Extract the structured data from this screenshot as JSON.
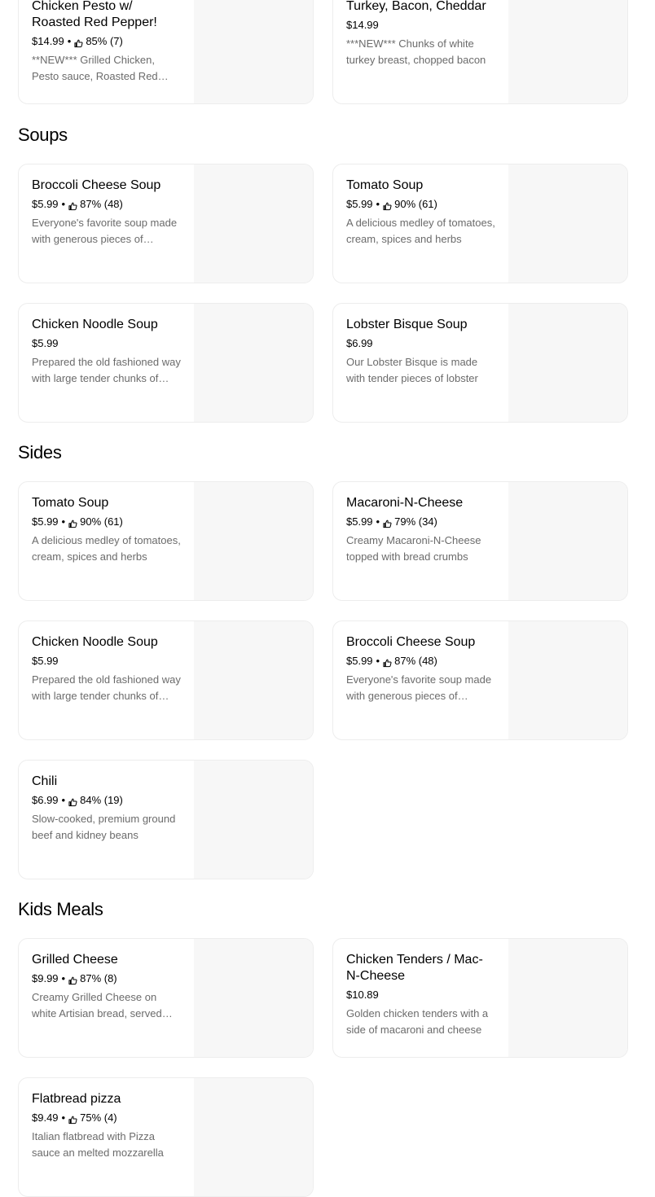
{
  "top_cards": [
    {
      "name": "Chicken Pesto w/ Roasted Red Pepper!",
      "price": "$14.99",
      "rating": "85% (7)",
      "desc": "**NEW*** Grilled Chicken, Pesto sauce, Roasted Red Pepper"
    },
    {
      "name": "Turkey, Bacon, Cheddar",
      "price": "$14.99",
      "rating": "",
      "desc": "***NEW*** Chunks of white turkey breast, chopped bacon"
    }
  ],
  "sections": [
    {
      "title": "Soups",
      "items": [
        {
          "name": "Broccoli Cheese Soup",
          "price": "$5.99",
          "rating": "87% (48)",
          "desc": "Everyone's favorite soup made with generous pieces of broccoli"
        },
        {
          "name": "Tomato Soup",
          "price": "$5.99",
          "rating": "90% (61)",
          "desc": "A delicious medley of tomatoes, cream, spices and herbs"
        },
        {
          "name": "Chicken Noodle Soup",
          "price": "$5.99",
          "rating": "",
          "desc": "Prepared the old fashioned way with large tender chunks of chicken"
        },
        {
          "name": "Lobster Bisque Soup",
          "price": "$6.99",
          "rating": "",
          "desc": "Our Lobster Bisque is made with tender pieces of lobster"
        }
      ]
    },
    {
      "title": "Sides",
      "items": [
        {
          "name": "Tomato Soup",
          "price": "$5.99",
          "rating": "90% (61)",
          "desc": "A delicious medley of tomatoes, cream, spices and herbs"
        },
        {
          "name": "Macaroni-N-Cheese",
          "price": "$5.99",
          "rating": "79% (34)",
          "desc": "Creamy Macaroni-N-Cheese topped with bread crumbs"
        },
        {
          "name": "Chicken Noodle Soup",
          "price": "$5.99",
          "rating": "",
          "desc": "Prepared the old fashioned way with large tender chunks of chicken"
        },
        {
          "name": "Broccoli Cheese Soup",
          "price": "$5.99",
          "rating": "87% (48)",
          "desc": "Everyone's favorite soup made with generous pieces of broccoli"
        },
        {
          "name": "Chili",
          "price": "$6.99",
          "rating": "84% (19)",
          "desc": "Slow-cooked, premium ground beef and kidney beans"
        }
      ]
    },
    {
      "title": "Kids Meals",
      "items": [
        {
          "name": "Grilled Cheese",
          "price": "$9.99",
          "rating": "87% (8)",
          "desc": "Creamy Grilled Cheese on white Artisian bread, served with chips"
        },
        {
          "name": "Chicken Tenders / Mac-N-Cheese",
          "price": "$10.89",
          "rating": "",
          "desc": "Golden chicken tenders with a side of macaroni and cheese"
        },
        {
          "name": "Flatbread pizza",
          "price": "$9.49",
          "rating": "75% (4)",
          "desc": "Italian flatbread with Pizza sauce an melted mozzarella"
        }
      ]
    }
  ]
}
